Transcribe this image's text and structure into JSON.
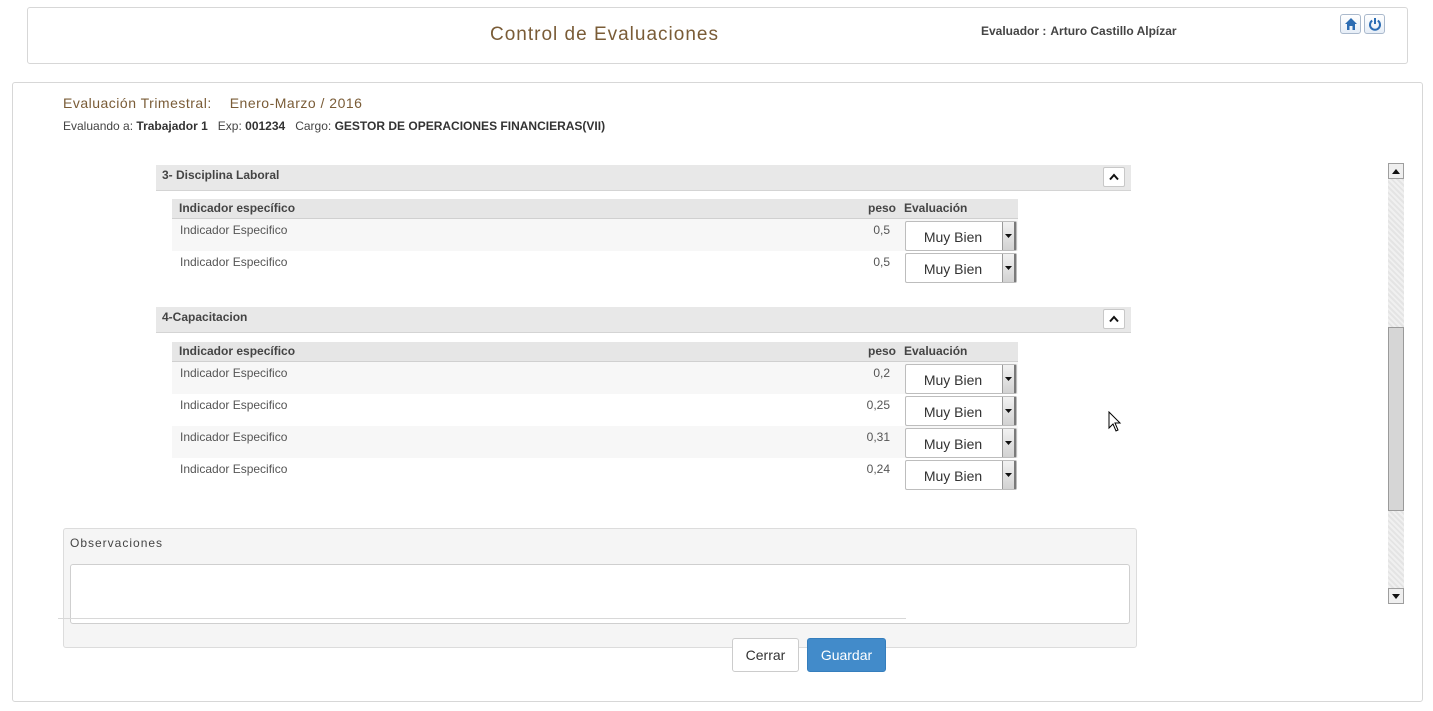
{
  "header": {
    "title": "Control de Evaluaciones",
    "evaluator_label": "Evaluador :",
    "evaluator_name": "Arturo Castillo Alpízar",
    "icons": [
      "home-icon",
      "power-icon"
    ]
  },
  "evaluation": {
    "period_label": "Evaluación Trimestral:",
    "period_value": "Enero-Marzo / 2016",
    "evaluee_label": "Evaluando a:",
    "evaluee_name": "Trabajador 1",
    "exp_label": "Exp:",
    "exp_value": "001234",
    "cargo_label": "Cargo:",
    "cargo_value": "GESTOR DE OPERACIONES FINANCIERAS(VII)"
  },
  "columns": {
    "indicator": "Indicador específico",
    "peso": "peso",
    "evaluacion": "Evaluación"
  },
  "sections": [
    {
      "title": "3- Disciplina Laboral",
      "rows": [
        {
          "name": "Indicador Especifico",
          "peso": "0,5",
          "evaluacion": "Muy Bien"
        },
        {
          "name": "Indicador Especifico",
          "peso": "0,5",
          "evaluacion": "Muy Bien"
        }
      ]
    },
    {
      "title": "4-Capacitacion",
      "rows": [
        {
          "name": "Indicador Especifico",
          "peso": "0,2",
          "evaluacion": "Muy Bien"
        },
        {
          "name": "Indicador Especifico",
          "peso": "0,25",
          "evaluacion": "Muy Bien"
        },
        {
          "name": "Indicador Especifico",
          "peso": "0,31",
          "evaluacion": "Muy Bien"
        },
        {
          "name": "Indicador Especifico",
          "peso": "0,24",
          "evaluacion": "Muy Bien"
        }
      ]
    }
  ],
  "observaciones": {
    "label": "Observaciones",
    "value": ""
  },
  "buttons": {
    "close": "Cerrar",
    "save": "Guardar"
  },
  "colors": {
    "title_brown": "#7a5c37",
    "primary_button": "#428bca"
  }
}
